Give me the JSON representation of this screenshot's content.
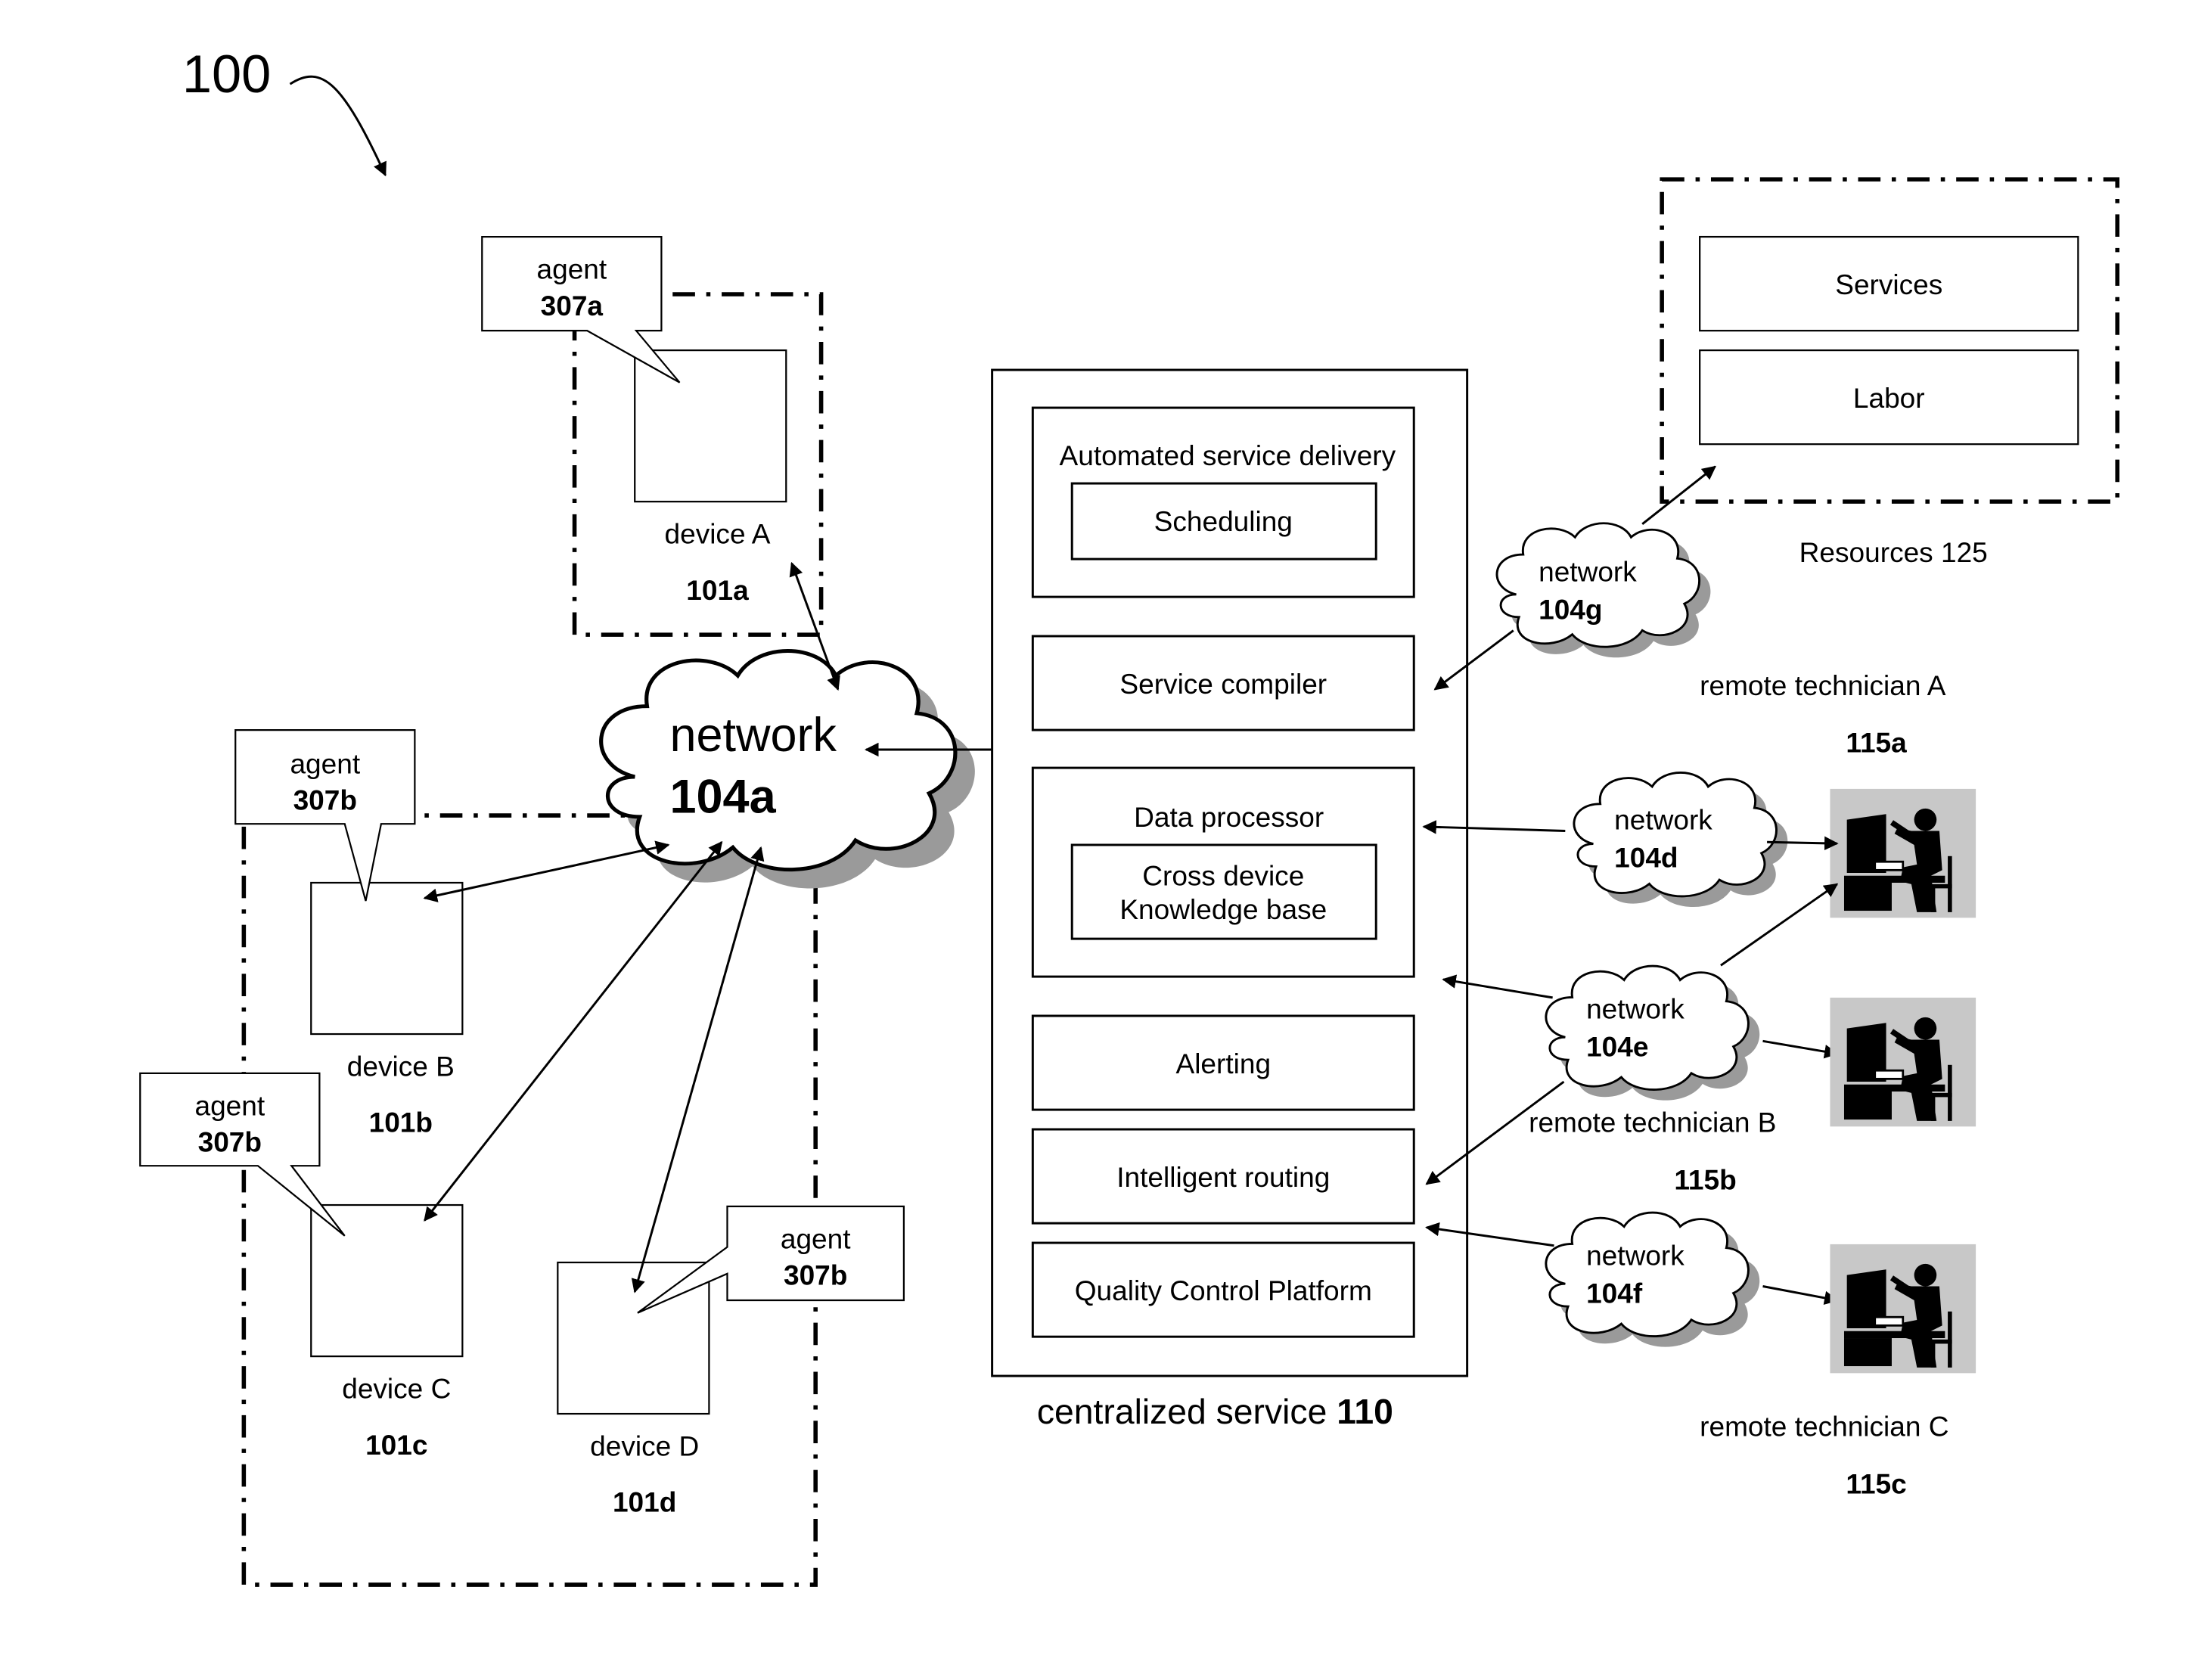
{
  "figure": {
    "reference_number": "100",
    "devices": [
      {
        "name": "device A",
        "id": "101a",
        "agent_label": "agent",
        "agent_id": "307a"
      },
      {
        "name": "device B",
        "id": "101b",
        "agent_label": "agent",
        "agent_id": "307b"
      },
      {
        "name": "device C",
        "id": "101c",
        "agent_label": "agent",
        "agent_id": "307b"
      },
      {
        "name": "device D",
        "id": "101d",
        "agent_label": "agent",
        "agent_id": "307b"
      }
    ],
    "networks": {
      "a": {
        "label": "network",
        "id": "104a"
      },
      "d": {
        "label": "network",
        "id": "104d"
      },
      "e": {
        "label": "network",
        "id": "104e"
      },
      "f": {
        "label": "network",
        "id": "104f"
      },
      "g": {
        "label": "network",
        "id": "104g"
      }
    },
    "centralized_service": {
      "label": "centralized service",
      "id": "110",
      "modules": {
        "automated_service_delivery": "Automated service delivery",
        "scheduling": "Scheduling",
        "service_compiler": "Service compiler",
        "data_processor": "Data processor",
        "knowledge_base_line1": "Cross device",
        "knowledge_base_line2": "Knowledge base",
        "alerting": "Alerting",
        "intelligent_routing": "Intelligent routing",
        "quality_control": "Quality Control Platform"
      }
    },
    "resources": {
      "label": "Resources 125",
      "items": [
        "Services",
        "Labor"
      ]
    },
    "technicians": [
      {
        "name": "remote technician A",
        "id": "115a"
      },
      {
        "name": "remote technician B",
        "id": "115b"
      },
      {
        "name": "remote technician C",
        "id": "115c"
      }
    ]
  }
}
